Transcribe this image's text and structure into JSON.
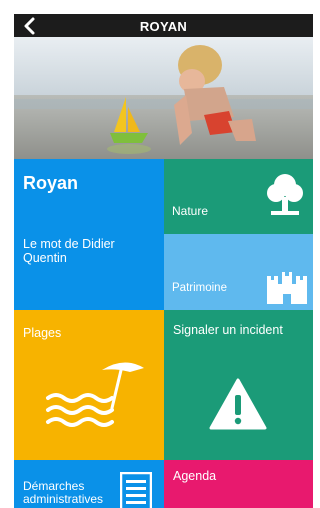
{
  "header": {
    "title": "ROYAN",
    "back_icon": "chevron-left-icon"
  },
  "hero": {
    "description_icon": "beach-photo"
  },
  "tiles": {
    "royan": {
      "title": "Royan",
      "subtitle": "Le mot de Didier Quentin",
      "color": "#0a91e8"
    },
    "nature": {
      "label": "Nature",
      "icon": "tree-icon",
      "color": "#1b9b78"
    },
    "patrimoine": {
      "label": "Patrimoine",
      "icon": "castle-icon",
      "color": "#5fb9ee"
    },
    "plages": {
      "label": "Plages",
      "icon": "beach-umbrella-icon",
      "color": "#f7b300"
    },
    "incident": {
      "label": "Signaler un incident",
      "icon": "warning-icon",
      "color": "#1b9b78"
    },
    "demarches": {
      "label": "Démarches administratives",
      "icon": "document-icon",
      "color": "#0a91e8"
    },
    "agenda": {
      "label": "Agenda",
      "color": "#e8196e"
    }
  }
}
